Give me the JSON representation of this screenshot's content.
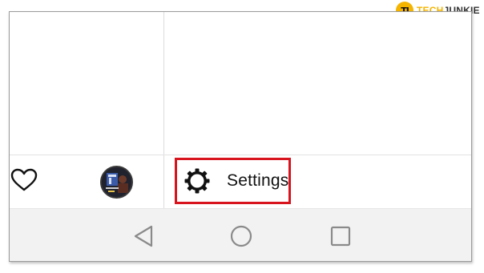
{
  "watermark": {
    "brand_prefix": "TECH",
    "brand_suffix": "JUNKIE",
    "badge_letters": "TJ"
  },
  "drawer": {
    "settings_label": "Settings",
    "settings_icon": "gear-icon",
    "heart_icon": "heart-icon",
    "avatar": "profile-avatar"
  },
  "navbar": {
    "back_icon": "back-triangle-icon",
    "home_icon": "home-circle-icon",
    "recents_icon": "recents-square-icon"
  },
  "colors": {
    "highlight": "#d8141e",
    "navbar_bg": "#f2f2f2",
    "accent": "#f5b400"
  }
}
